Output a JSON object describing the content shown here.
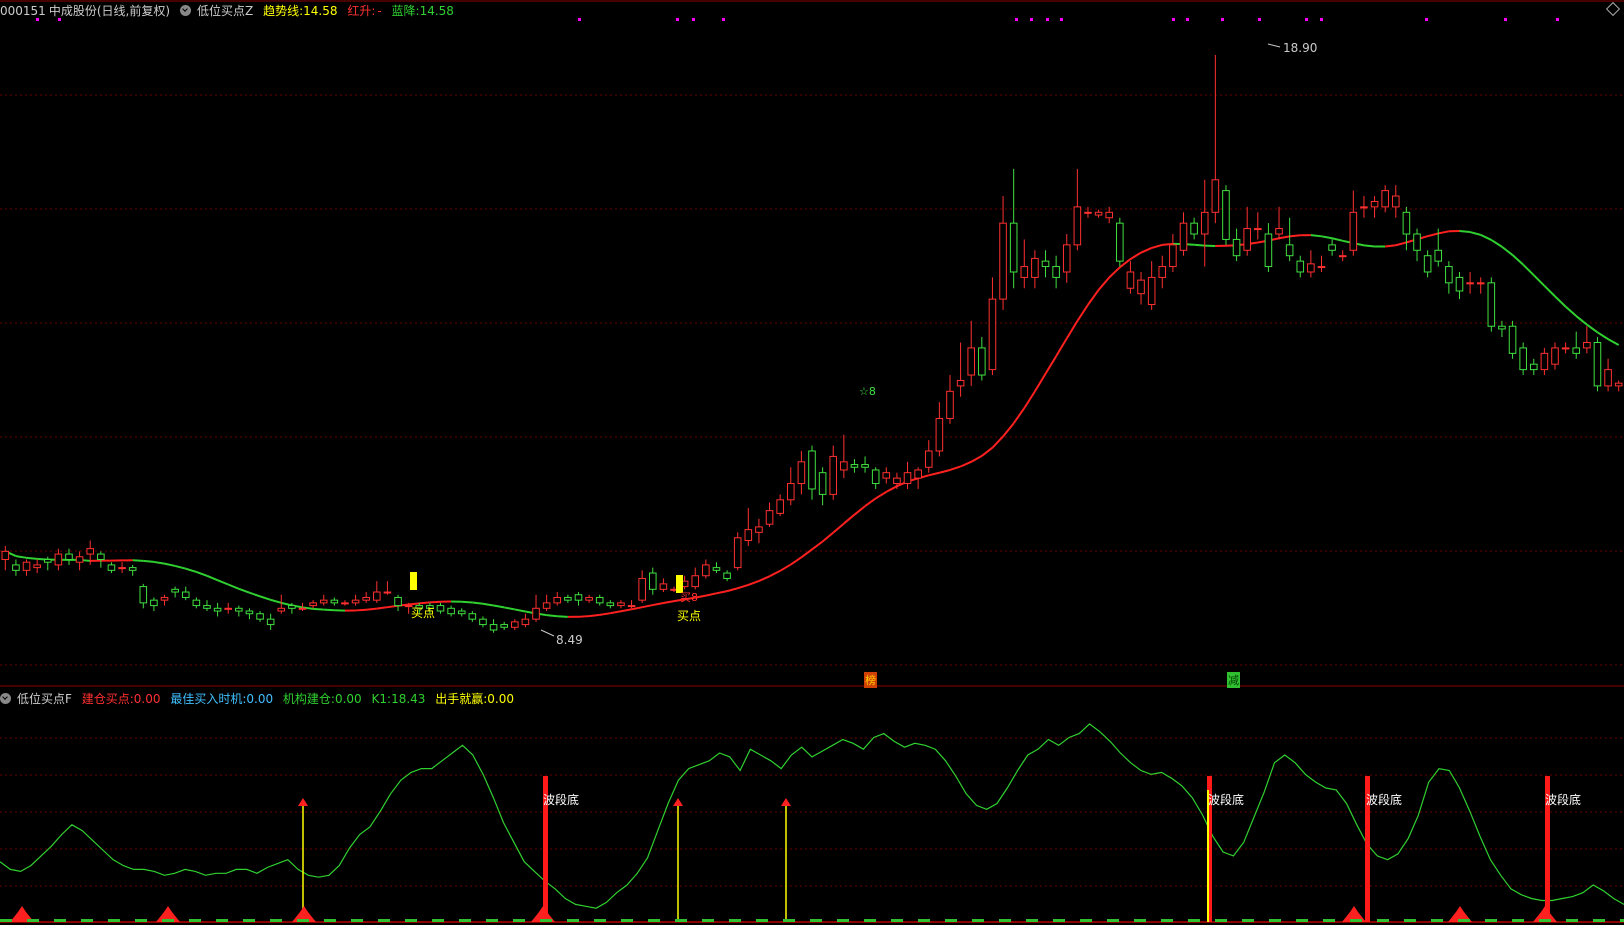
{
  "header": {
    "stock_code": "000151",
    "stock_name": "中成股份",
    "period": "(日线,前复权)",
    "indicator_name": "低位买点Z",
    "trend_label": "趋势线:",
    "trend_value": "14.58",
    "red_up_label": "红升:",
    "red_up_value": "-",
    "blue_down_label": "蓝降:",
    "blue_down_value": "14.58"
  },
  "sub_header": {
    "indicator_name": "低位买点F",
    "build_label": "建仓买点:",
    "build_value": "0.00",
    "best_label": "最佳买入时机:",
    "best_value": "0.00",
    "inst_label": "机构建仓:",
    "inst_value": "0.00",
    "k1_label": "K1:",
    "k1_value": "18.43",
    "win_label": "出手就赢:",
    "win_value": "0.00"
  },
  "annotations": {
    "high_price": "18.90",
    "low_price": "8.49",
    "buy_label": "买点",
    "star_label": "☆8",
    "buy_label_2": "买8",
    "marker_1": "榜",
    "marker_2": "减",
    "wave_bottom": "波段底"
  },
  "colors": {
    "up": "#ff3030",
    "down": "#40e040",
    "trend_red": "#ff2020",
    "trend_green": "#30d030",
    "yellow": "#ffff00",
    "magenta": "#ff00ff",
    "grid": "#6a0000"
  },
  "chart_data": [
    {
      "type": "candlestick",
      "ylim": [
        7.5,
        19.5
      ],
      "high_marker": 18.9,
      "low_marker": 8.49,
      "candles": [
        [
          9.6,
          9.75,
          9.85,
          9.4
        ],
        [
          9.5,
          9.4,
          9.6,
          9.3
        ],
        [
          9.4,
          9.55,
          9.6,
          9.3
        ],
        [
          9.45,
          9.5,
          9.6,
          9.35
        ],
        [
          9.6,
          9.55,
          9.65,
          9.4
        ],
        [
          9.5,
          9.7,
          9.8,
          9.4
        ],
        [
          9.7,
          9.6,
          9.8,
          9.5
        ],
        [
          9.55,
          9.65,
          9.75,
          9.4
        ],
        [
          9.7,
          9.8,
          9.95,
          9.5
        ],
        [
          9.7,
          9.6,
          9.75,
          9.45
        ],
        [
          9.5,
          9.4,
          9.55,
          9.35
        ],
        [
          9.45,
          9.45,
          9.55,
          9.35
        ],
        [
          9.45,
          9.4,
          9.5,
          9.3
        ],
        [
          9.1,
          8.8,
          9.15,
          8.7
        ],
        [
          8.85,
          8.75,
          8.9,
          8.65
        ],
        [
          8.85,
          8.9,
          8.95,
          8.75
        ],
        [
          9.05,
          9.0,
          9.1,
          8.9
        ],
        [
          9.0,
          8.9,
          9.1,
          8.85
        ],
        [
          8.85,
          8.75,
          8.9,
          8.7
        ],
        [
          8.75,
          8.7,
          8.85,
          8.65
        ],
        [
          8.7,
          8.65,
          8.8,
          8.55
        ],
        [
          8.7,
          8.7,
          8.8,
          8.6
        ],
        [
          8.7,
          8.65,
          8.75,
          8.55
        ],
        [
          8.65,
          8.6,
          8.7,
          8.5
        ],
        [
          8.6,
          8.5,
          8.65,
          8.45
        ],
        [
          8.5,
          8.4,
          8.6,
          8.3
        ],
        [
          8.65,
          8.7,
          8.95,
          8.6
        ],
        [
          8.75,
          8.7,
          8.8,
          8.6
        ],
        [
          8.7,
          8.7,
          8.8,
          8.65
        ],
        [
          8.75,
          8.8,
          8.85,
          8.7
        ],
        [
          8.8,
          8.85,
          8.95,
          8.75
        ],
        [
          8.85,
          8.8,
          8.9,
          8.75
        ],
        [
          8.8,
          8.8,
          8.85,
          8.75
        ],
        [
          8.8,
          8.85,
          8.95,
          8.75
        ],
        [
          8.85,
          8.9,
          9.0,
          8.8
        ],
        [
          8.85,
          9.0,
          9.2,
          8.8
        ],
        [
          9.0,
          9.0,
          9.2,
          8.95
        ],
        [
          8.9,
          8.75,
          8.95,
          8.65
        ],
        [
          8.75,
          8.75,
          8.8,
          8.6
        ],
        [
          8.75,
          8.7,
          8.8,
          8.6
        ],
        [
          8.75,
          8.7,
          8.8,
          8.6
        ],
        [
          8.75,
          8.65,
          8.8,
          8.6
        ],
        [
          8.7,
          8.6,
          8.75,
          8.55
        ],
        [
          8.65,
          8.6,
          8.7,
          8.55
        ],
        [
          8.6,
          8.5,
          8.65,
          8.45
        ],
        [
          8.5,
          8.4,
          8.55,
          8.35
        ],
        [
          8.4,
          8.3,
          8.5,
          8.25
        ],
        [
          8.4,
          8.35,
          8.45,
          8.3
        ],
        [
          8.35,
          8.45,
          8.5,
          8.3
        ],
        [
          8.4,
          8.5,
          8.6,
          8.35
        ],
        [
          8.5,
          8.7,
          8.95,
          8.45
        ],
        [
          8.7,
          8.8,
          8.95,
          8.65
        ],
        [
          8.8,
          8.9,
          9.0,
          8.75
        ],
        [
          8.9,
          8.85,
          8.95,
          8.8
        ],
        [
          8.95,
          8.85,
          9.0,
          8.75
        ],
        [
          8.85,
          8.9,
          8.95,
          8.8
        ],
        [
          8.9,
          8.8,
          8.95,
          8.75
        ],
        [
          8.8,
          8.75,
          8.85,
          8.7
        ],
        [
          8.75,
          8.8,
          8.85,
          8.7
        ],
        [
          8.75,
          8.75,
          8.85,
          8.7
        ],
        [
          8.85,
          9.25,
          9.4,
          8.8
        ],
        [
          9.35,
          9.05,
          9.45,
          8.95
        ],
        [
          9.05,
          9.15,
          9.25,
          9.0
        ],
        [
          9.05,
          9.05,
          9.1,
          9.0
        ],
        [
          9.1,
          9.2,
          9.3,
          9.05
        ],
        [
          9.1,
          9.3,
          9.45,
          9.05
        ],
        [
          9.3,
          9.5,
          9.6,
          9.25
        ],
        [
          9.45,
          9.4,
          9.55,
          9.35
        ],
        [
          9.35,
          9.25,
          9.4,
          9.2
        ],
        [
          9.45,
          10.0,
          10.1,
          9.4
        ],
        [
          9.95,
          10.15,
          10.55,
          9.85
        ],
        [
          10.1,
          10.2,
          10.35,
          9.9
        ],
        [
          10.25,
          10.5,
          10.65,
          10.2
        ],
        [
          10.45,
          10.7,
          10.8,
          10.4
        ],
        [
          10.7,
          11.0,
          11.3,
          10.6
        ],
        [
          11.0,
          11.4,
          11.6,
          10.8
        ],
        [
          11.6,
          10.9,
          11.7,
          10.7
        ],
        [
          11.2,
          10.8,
          11.3,
          10.6
        ],
        [
          10.8,
          11.5,
          11.7,
          10.7
        ],
        [
          11.25,
          11.4,
          11.9,
          11.1
        ],
        [
          11.35,
          11.3,
          11.45,
          11.2
        ],
        [
          11.35,
          11.3,
          11.5,
          11.2
        ],
        [
          11.25,
          11.0,
          11.3,
          10.9
        ],
        [
          11.1,
          11.2,
          11.3,
          11.0
        ],
        [
          11.0,
          11.1,
          11.2,
          10.9
        ],
        [
          11.0,
          11.2,
          11.4,
          10.9
        ],
        [
          11.1,
          11.25,
          11.3,
          10.9
        ],
        [
          11.3,
          11.6,
          11.8,
          11.2
        ],
        [
          11.6,
          12.2,
          12.5,
          11.5
        ],
        [
          12.2,
          12.7,
          13.0,
          12.1
        ],
        [
          12.8,
          12.9,
          13.6,
          12.6
        ],
        [
          13.0,
          13.5,
          14.0,
          12.8
        ],
        [
          13.5,
          13.0,
          13.7,
          12.9
        ],
        [
          13.1,
          14.4,
          14.8,
          13.0
        ],
        [
          14.4,
          15.8,
          16.3,
          14.2
        ],
        [
          15.8,
          14.9,
          16.8,
          14.6
        ],
        [
          14.8,
          15.0,
          15.5,
          14.6
        ],
        [
          14.8,
          15.15,
          15.3,
          14.6
        ],
        [
          15.1,
          15.0,
          15.3,
          14.8
        ],
        [
          15.0,
          14.8,
          15.2,
          14.6
        ],
        [
          14.9,
          15.4,
          15.6,
          14.7
        ],
        [
          15.4,
          16.1,
          16.8,
          15.3
        ],
        [
          16.0,
          16.0,
          16.1,
          15.9
        ],
        [
          15.95,
          16.0,
          16.05,
          15.9
        ],
        [
          15.9,
          16.0,
          16.1,
          15.8
        ],
        [
          15.8,
          15.1,
          15.9,
          15.0
        ],
        [
          14.6,
          14.9,
          15.1,
          14.5
        ],
        [
          14.5,
          14.75,
          14.9,
          14.3
        ],
        [
          14.3,
          14.8,
          15.1,
          14.2
        ],
        [
          14.8,
          15.0,
          15.2,
          14.6
        ],
        [
          15.0,
          15.4,
          15.6,
          14.9
        ],
        [
          15.3,
          15.8,
          16.0,
          15.2
        ],
        [
          15.8,
          15.6,
          15.9,
          15.5
        ],
        [
          15.6,
          16.0,
          16.6,
          15.0
        ],
        [
          16.0,
          16.6,
          18.9,
          15.8
        ],
        [
          16.4,
          15.5,
          16.5,
          15.4
        ],
        [
          15.5,
          15.2,
          15.7,
          15.1
        ],
        [
          15.3,
          15.7,
          16.1,
          15.2
        ],
        [
          15.7,
          15.7,
          16.0,
          15.5
        ],
        [
          15.6,
          15.0,
          15.8,
          14.9
        ],
        [
          15.6,
          15.7,
          16.1,
          15.5
        ],
        [
          15.4,
          15.2,
          15.9,
          15.1
        ],
        [
          15.1,
          14.9,
          15.2,
          14.8
        ],
        [
          14.9,
          15.05,
          15.3,
          14.8
        ],
        [
          15.0,
          15.0,
          15.2,
          14.9
        ],
        [
          15.4,
          15.3,
          15.5,
          15.2
        ],
        [
          15.2,
          15.2,
          15.3,
          15.1
        ],
        [
          15.3,
          16.0,
          16.4,
          15.2
        ],
        [
          16.1,
          16.1,
          16.3,
          15.9
        ],
        [
          16.1,
          16.2,
          16.3,
          15.9
        ],
        [
          16.1,
          16.4,
          16.5,
          16.0
        ],
        [
          16.1,
          16.3,
          16.5,
          15.9
        ],
        [
          16.0,
          15.6,
          16.1,
          15.3
        ],
        [
          15.6,
          15.3,
          15.7,
          15.1
        ],
        [
          15.2,
          14.9,
          15.3,
          14.8
        ],
        [
          15.3,
          15.1,
          15.7,
          15.0
        ],
        [
          15.0,
          14.7,
          15.1,
          14.5
        ],
        [
          14.8,
          14.55,
          14.9,
          14.4
        ],
        [
          14.7,
          14.7,
          14.9,
          14.5
        ],
        [
          14.7,
          14.7,
          14.8,
          14.5
        ],
        [
          14.7,
          13.9,
          14.8,
          13.8
        ],
        [
          13.9,
          13.85,
          14.0,
          13.7
        ],
        [
          13.9,
          13.4,
          14.0,
          13.3
        ],
        [
          13.5,
          13.1,
          13.6,
          13.0
        ],
        [
          13.2,
          13.1,
          13.3,
          13.0
        ],
        [
          13.1,
          13.4,
          13.5,
          13.0
        ],
        [
          13.2,
          13.5,
          13.6,
          13.1
        ],
        [
          13.5,
          13.5,
          13.6,
          13.4
        ],
        [
          13.5,
          13.4,
          13.8,
          13.3
        ],
        [
          13.5,
          13.6,
          13.9,
          13.4
        ],
        [
          13.6,
          12.8,
          13.7,
          12.7
        ],
        [
          12.8,
          13.1,
          13.3,
          12.7
        ],
        [
          12.8,
          12.85,
          12.9,
          12.7
        ]
      ]
    },
    {
      "type": "line",
      "name": "K1",
      "ylim": [
        0,
        100
      ],
      "values": [
        28,
        24,
        23,
        26,
        31,
        36,
        42,
        47,
        44,
        39,
        34,
        29,
        26,
        24,
        24,
        23,
        21,
        22,
        24,
        23,
        21,
        22,
        22,
        24,
        24,
        22,
        25,
        27,
        29,
        24,
        21,
        20,
        21,
        26,
        35,
        42,
        46,
        54,
        63,
        70,
        74,
        76,
        76,
        80,
        84,
        88,
        83,
        73,
        61,
        48,
        38,
        28,
        23,
        18,
        14,
        9,
        6,
        5,
        4,
        7,
        12,
        16,
        22,
        30,
        44,
        58,
        70,
        76,
        78,
        80,
        84,
        82,
        75,
        86,
        83,
        80,
        76,
        83,
        87,
        82,
        85,
        88,
        91,
        89,
        86,
        92,
        94,
        90,
        87,
        89,
        88,
        86,
        80,
        72,
        63,
        57,
        55,
        58,
        66,
        75,
        83,
        86,
        91,
        88,
        92,
        94,
        99,
        95,
        90,
        84,
        79,
        75,
        73,
        74,
        71,
        67,
        61,
        52,
        41,
        33,
        31,
        38,
        51,
        64,
        79,
        83,
        79,
        73,
        69,
        66,
        65,
        58,
        47,
        37,
        31,
        29,
        32,
        40,
        52,
        69,
        76,
        75,
        66,
        54,
        41,
        29,
        21,
        14,
        11,
        9,
        8,
        8,
        9,
        10,
        12,
        16,
        13,
        9,
        6
      ]
    }
  ]
}
